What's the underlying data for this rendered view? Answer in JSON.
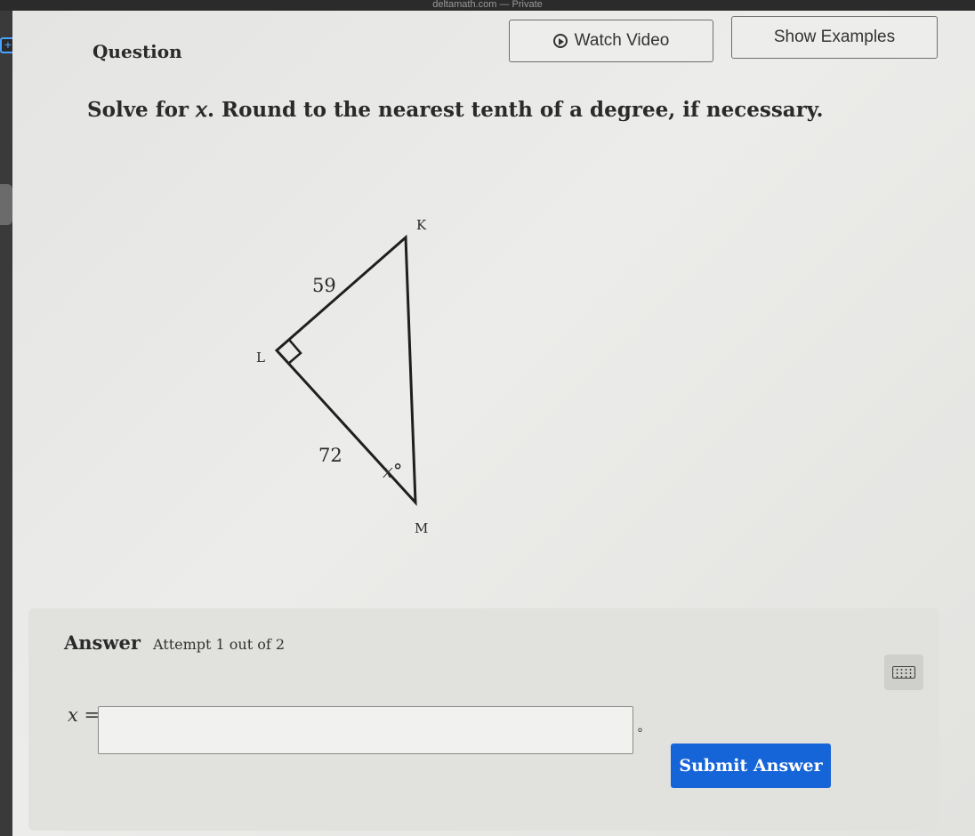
{
  "browser": {
    "title": "deltamath.com — Private"
  },
  "header": {
    "question_label": "Question",
    "watch_video_label": "Watch Video",
    "show_examples_label": "Show Examples"
  },
  "problem": {
    "prompt": "Solve for 𝑥. Round to the nearest tenth of a degree, if necessary."
  },
  "diagram": {
    "vertex_k": "K",
    "vertex_l": "L",
    "vertex_m": "M",
    "side_lk": "59",
    "side_lm": "72",
    "angle_m": "x°"
  },
  "answer": {
    "title": "Answer",
    "attempt": "Attempt 1 out of 2",
    "variable": "x =",
    "input_value": "",
    "unit": "°",
    "submit_label": "Submit Answer"
  },
  "colors": {
    "submit_button": "#1665d8",
    "plus_icon": "#4aa3ff"
  },
  "icons": {
    "video": "play-circle-icon",
    "keyboard": "keyboard-icon",
    "add": "plus-icon"
  }
}
